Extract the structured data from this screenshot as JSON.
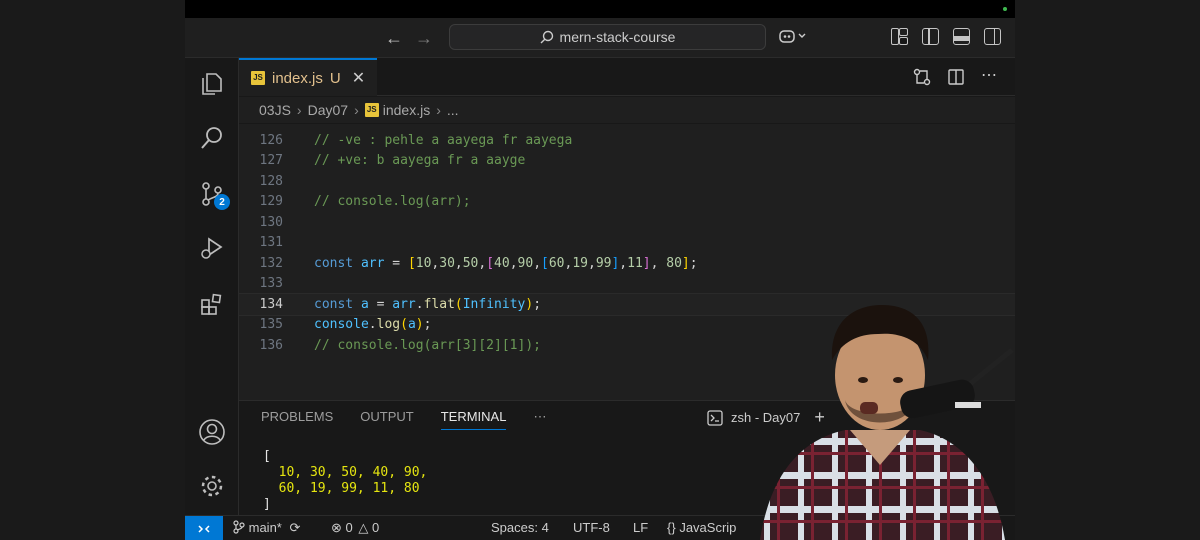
{
  "titlebar": {
    "search_label": "mern-stack-course"
  },
  "activity_bar": {
    "source_control_badge": "2"
  },
  "tab": {
    "filename": "index.js",
    "modified": "U",
    "file_icon_text": "JS"
  },
  "breadcrumb": {
    "parts": [
      "03JS",
      "Day07",
      "index.js",
      "..."
    ]
  },
  "editor": {
    "lines": [
      {
        "n": "126",
        "text": "// -ve : pehle a aayega fr aayega"
      },
      {
        "n": "127",
        "text": "// +ve: b aayega fr a aayge"
      },
      {
        "n": "128",
        "text": ""
      },
      {
        "n": "129",
        "text": "// console.log(arr);"
      },
      {
        "n": "130",
        "text": ""
      },
      {
        "n": "131",
        "text": ""
      },
      {
        "n": "132",
        "text": "const arr = [10,30,50,[40,90,[60,19,99],11], 80];"
      },
      {
        "n": "133",
        "text": ""
      },
      {
        "n": "134",
        "text": "const a = arr.flat(Infinity);"
      },
      {
        "n": "135",
        "text": "console.log(a);"
      },
      {
        "n": "136",
        "text": "// console.log(arr[3][2][1]);"
      }
    ],
    "active_line": "134"
  },
  "panel": {
    "tabs": [
      "PROBLEMS",
      "OUTPUT",
      "TERMINAL"
    ],
    "active_tab": "TERMINAL",
    "more": "⋯",
    "terminal_name": "zsh - Day07",
    "terminal_output": [
      "[",
      "  10, 30, 50, 40, 90,",
      "  60, 19, 99, 11, 80",
      "]"
    ]
  },
  "statusbar": {
    "branch": "main*",
    "errors": "0",
    "warnings": "0",
    "spaces": "Spaces: 4",
    "encoding": "UTF-8",
    "eol": "LF",
    "language": "JavaScrip"
  },
  "colors": {
    "accent": "#0078d4",
    "editor_bg": "#1f1f1f",
    "comment": "#6a9955",
    "keyword": "#569cd6",
    "variable": "#4fc1ff",
    "function": "#dcdcaa",
    "number": "#b5cea8",
    "terminal_number": "#e5e510"
  },
  "icons": [
    "back-arrow-icon",
    "forward-arrow-icon",
    "search-icon",
    "copilot-icon",
    "explorer-icon",
    "search-view-icon",
    "source-control-icon",
    "run-debug-icon",
    "extensions-icon",
    "account-icon",
    "settings-gear-icon",
    "compare-icon",
    "split-editor-icon",
    "more-actions-icon",
    "terminal-icon",
    "add-terminal-icon",
    "close-icon",
    "branch-icon",
    "sync-icon",
    "error-icon",
    "warning-icon",
    "braces-icon"
  ]
}
